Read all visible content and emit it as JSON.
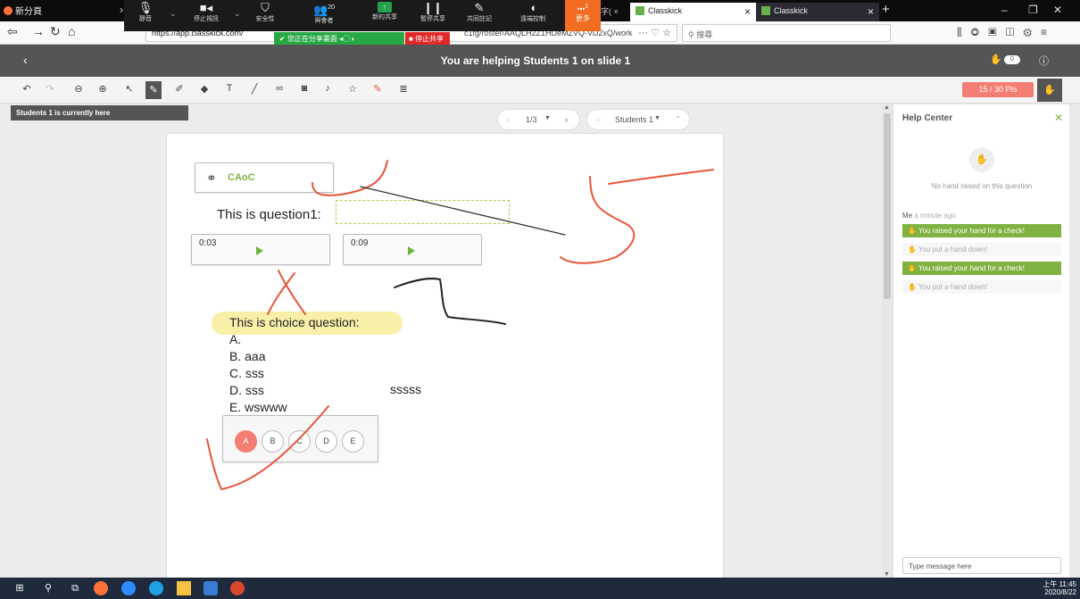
{
  "browser": {
    "first_tab": "新分頁",
    "partial_tab": "字( ×",
    "tabs": [
      {
        "label": "Classkick"
      },
      {
        "label": "Classkick"
      }
    ],
    "url_prefix": "https://app.classkick.com/",
    "url_tail": "c1fg/roster/AAQLH2Z1HDeMZVQ-ViJ2xQ/work",
    "search_placeholder": "搜尋"
  },
  "zoom": {
    "items": [
      {
        "label": "靜音"
      },
      {
        "label": "停止視訊"
      },
      {
        "label": "安全性"
      },
      {
        "label": "與會者"
      },
      {
        "label": "新的共享"
      },
      {
        "label": "暫停共享"
      },
      {
        "label": "共同註記"
      },
      {
        "label": "遠端控制"
      }
    ],
    "participants": "20",
    "more_label": "更多",
    "more_badge": "1",
    "sharing_label": "您正在分享畫面",
    "stop_share": "停止共享"
  },
  "header": {
    "title": "You are helping Students 1 on slide 1",
    "hand_count": "0"
  },
  "points": "15 / 30 Pts",
  "work": {
    "here_label": "Students 1 is currently here",
    "slide_pager": "1/3",
    "student_name": "Students 1",
    "link_text": "CAoC",
    "question1": "This is question1:",
    "audio": [
      "0:03",
      "0:09"
    ],
    "choice_title": "This is choice question:",
    "choices": [
      "A.",
      "B. aaa",
      "C. sss",
      "D. sss",
      "E. wswww"
    ],
    "extra_text": "sssss",
    "options": [
      "A",
      "B",
      "C",
      "D",
      "E"
    ]
  },
  "help": {
    "title": "Help Center",
    "no_hand": "No hand raised on this question",
    "me": "Me",
    "ago": "a minute ago",
    "messages": [
      {
        "text": "You raised your hand for a check!",
        "kind": "up"
      },
      {
        "text": "You put a hand down!",
        "kind": "down"
      },
      {
        "text": "You raised your hand for a check!",
        "kind": "up"
      },
      {
        "text": "You put a hand down!",
        "kind": "down"
      }
    ],
    "input_placeholder": "Type message here"
  },
  "clock": {
    "time": "上午 11:45",
    "date": "2020/8/22"
  },
  "colors": {
    "accent_green": "#7fb241",
    "accent_red": "#f47d74",
    "ink": "#e8553a"
  }
}
